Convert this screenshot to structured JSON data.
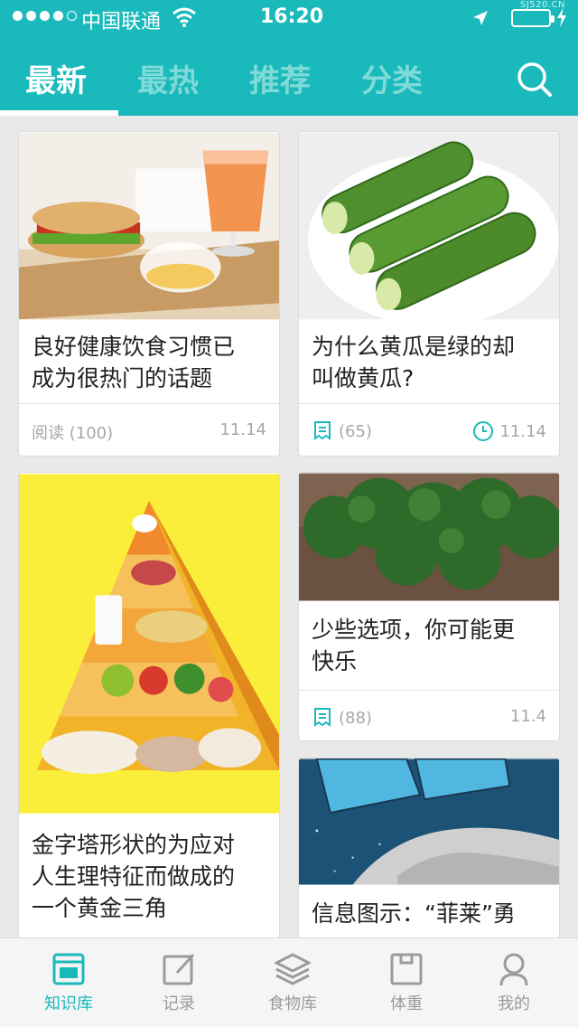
{
  "status_bar": {
    "carrier": "中国联通",
    "time": "16:20",
    "watermark": "SJ520.CN"
  },
  "tabs": [
    {
      "label": "最新",
      "active": true
    },
    {
      "label": "最热",
      "active": false
    },
    {
      "label": "推荐",
      "active": false
    },
    {
      "label": "分类",
      "active": false
    }
  ],
  "search_icon": "search-icon",
  "cards": [
    {
      "title_line1": "良好健康饮食习惯已",
      "title_line2": "成为很热门的话题",
      "reads": "阅读 (100)",
      "date": "11.14",
      "image": "breakfast-photo"
    },
    {
      "title_line1": "为什么黄瓜是绿的却",
      "title_line2": "叫做黄瓜?",
      "count": "(65)",
      "date": "11.14",
      "image": "cucumber-photo",
      "icons": [
        "read-count-icon",
        "clock-icon"
      ]
    },
    {
      "title_line1": "金字塔形状的为应对",
      "title_line2": "人生理特征而做成的",
      "title_line3": "一个黄金三角",
      "image": "food-pyramid-illustration"
    },
    {
      "title_line1": "少些选项，你可能更",
      "title_line2": "快乐",
      "count": "(88)",
      "date": "11.4",
      "image": "kale-photo",
      "icons": [
        "read-count-icon"
      ]
    },
    {
      "title_line1": "信息图示：“菲莱”勇",
      "title_line2": "",
      "image": "comet-illustration"
    }
  ],
  "tabbar": [
    {
      "label": "知识库",
      "icon": "library-icon",
      "active": true
    },
    {
      "label": "记录",
      "icon": "edit-icon",
      "active": false
    },
    {
      "label": "食物库",
      "icon": "layers-icon",
      "active": false
    },
    {
      "label": "体重",
      "icon": "scale-icon",
      "active": false
    },
    {
      "label": "我的",
      "icon": "profile-icon",
      "active": false
    }
  ],
  "colors": {
    "accent": "#1ab9bb",
    "tab_inactive": "#7fdad8",
    "background": "#e9e9e9"
  }
}
